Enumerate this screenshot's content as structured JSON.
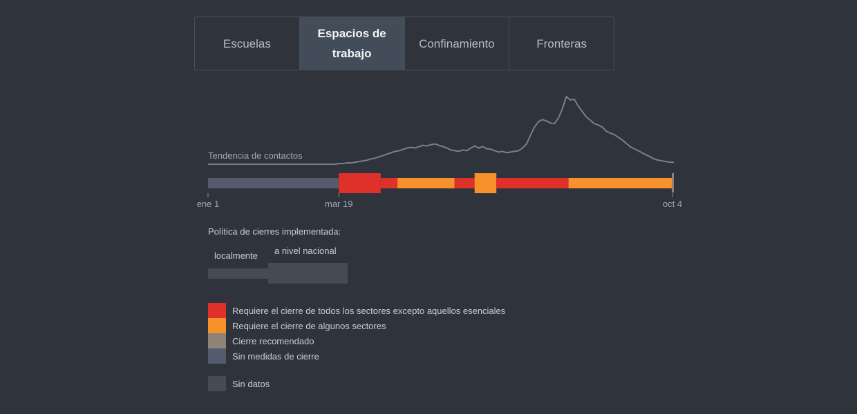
{
  "tabs": [
    {
      "label": "Escuelas",
      "active": false
    },
    {
      "label": "Espacios de trabajo",
      "active": true
    },
    {
      "label": "Confinamiento",
      "active": false
    },
    {
      "label": "Fronteras",
      "active": false
    }
  ],
  "chart_data": {
    "type": "area",
    "trend_label": "Tendencia de contactos",
    "x_ticks": [
      "ene 1",
      "mar 19",
      "oct 4"
    ],
    "timeline": [
      {
        "start": "ene 1",
        "end": "mar 18",
        "level": "Sin medidas de cierre",
        "scope": "localmente"
      },
      {
        "start": "mar 19",
        "end": "abr 12",
        "level": "Requiere el cierre de todos los sectores excepto aquellos esenciales",
        "scope": "a nivel nacional"
      },
      {
        "start": "abr 13",
        "end": "abr 22",
        "level": "Requiere el cierre de todos los sectores excepto aquellos esenciales",
        "scope": "localmente"
      },
      {
        "start": "abr 23",
        "end": "may 26",
        "level": "Requiere el cierre de algunos sectores",
        "scope": "localmente"
      },
      {
        "start": "may 27",
        "end": "jun 7",
        "level": "Requiere el cierre de todos los sectores excepto aquellos esenciales",
        "scope": "localmente"
      },
      {
        "start": "jun 8",
        "end": "jun 20",
        "level": "Requiere el cierre de algunos sectores",
        "scope": "a nivel nacional"
      },
      {
        "start": "jun 21",
        "end": "ago 2",
        "level": "Requiere el cierre de todos los sectores excepto aquellos esenciales",
        "scope": "localmente"
      },
      {
        "start": "ago 3",
        "end": "oct 3",
        "level": "Requiere el cierre de algunos sectores",
        "scope": "localmente"
      },
      {
        "start": "oct 4",
        "end": "oct 4",
        "level": "Cierre recomendado",
        "scope": "a nivel nacional"
      }
    ],
    "trend_values": [
      0,
      0,
      0,
      0,
      0,
      0,
      0,
      0,
      0,
      0,
      0,
      0,
      0,
      0,
      0,
      0,
      0,
      0,
      0,
      0,
      0,
      0,
      0,
      0,
      0,
      0,
      0,
      0,
      0,
      0,
      0,
      0,
      0,
      1,
      1,
      2,
      2,
      3,
      4,
      5,
      6,
      8,
      9,
      11,
      13,
      15,
      17,
      19,
      20,
      22,
      24,
      25,
      24,
      26,
      28,
      27,
      29,
      30,
      28,
      26,
      24,
      21,
      20,
      19,
      21,
      20,
      24,
      27,
      24,
      26,
      23,
      22,
      20,
      18,
      19,
      17,
      18,
      19,
      20,
      24,
      30,
      43,
      55,
      63,
      66,
      64,
      61,
      60,
      68,
      82,
      100,
      95,
      96,
      86,
      78,
      70,
      65,
      60,
      58,
      55,
      49,
      46,
      44,
      40,
      36,
      31,
      26,
      23,
      20,
      17,
      14,
      11,
      8,
      6,
      5,
      4,
      3,
      3
    ]
  },
  "policy_title": "Política de cierres implementada:",
  "scope_legend": {
    "local": "localmente",
    "national": "a nivel nacional"
  },
  "legend": [
    {
      "label": "Requiere el cierre de todos los sectores excepto aquellos esenciales",
      "color": "#e0302a"
    },
    {
      "label": "Requiere el cierre de algunos sectores",
      "color": "#f7922b"
    },
    {
      "label": "Cierre recomendado",
      "color": "#8e8378"
    },
    {
      "label": "Sin medidas de cierre",
      "color": "#545b6e"
    }
  ],
  "no_data": {
    "label": "Sin datos",
    "color": "#464b55"
  }
}
